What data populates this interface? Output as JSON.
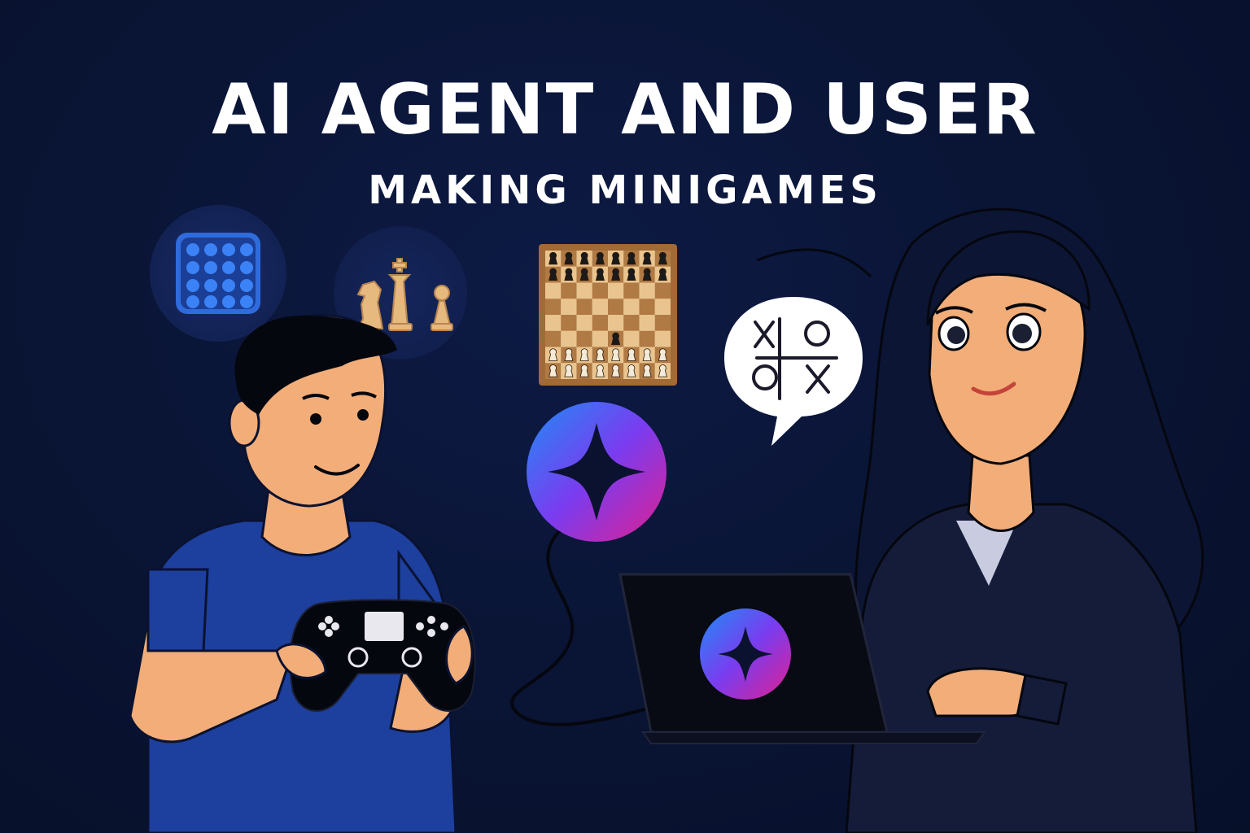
{
  "title": {
    "line1": "AI AGENT AND USER",
    "line2": "MAKING MINIGAMES"
  },
  "icons": {
    "dot_grid": "dot-grid-game-icon",
    "chess_pieces": "chess-pieces-icon",
    "chess_board": "chessboard-icon",
    "tictactoe_bubble": "tic-tac-toe-speech-bubble-icon",
    "ai_logo": "ai-sparkle-logo-icon",
    "laptop_logo": "ai-sparkle-laptop-logo-icon",
    "gamepad": "gamepad-icon"
  },
  "colors": {
    "background": "#0a1536",
    "title_text": "#ffffff",
    "grid_blue": "#2f6bdc",
    "chess_tan": "#e6b97f",
    "board_dark": "#b07a45",
    "board_light": "#e9c48f",
    "logo_start": "#1f8cf5",
    "logo_mid": "#7a3cf0",
    "logo_end": "#e0208f",
    "shirt_blue": "#1d3f9e",
    "skin": "#f2ad78",
    "suit": "#151c3a"
  }
}
